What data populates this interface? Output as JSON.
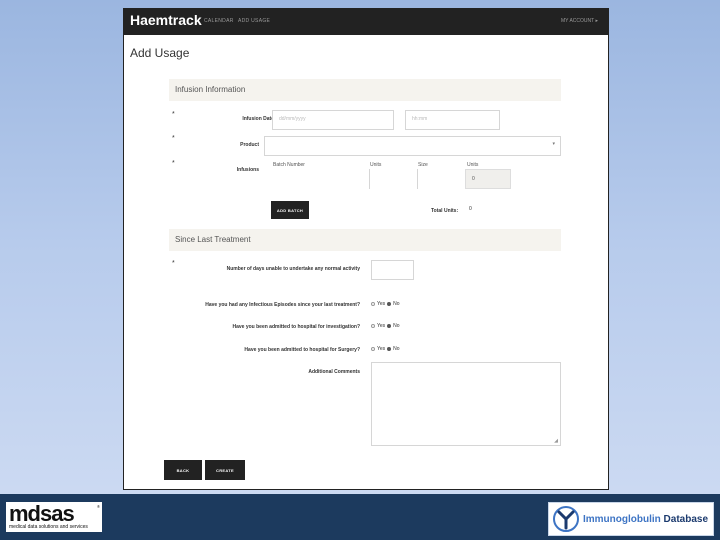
{
  "nav": {
    "brand": "Haemtrack",
    "links": [
      "CALENDAR",
      "ADD USAGE"
    ],
    "account": "MY ACCOUNT ▸"
  },
  "page": {
    "title": "Add Usage"
  },
  "infusion_section": {
    "heading": "Infusion Information",
    "required_mark": "*",
    "date_label": "Infusion Date",
    "date_placeholder": "dd/mm/yyyy",
    "time_placeholder": "hh:mm",
    "product_label": "Product",
    "infusions_label": "Infusions",
    "columns": [
      "Batch Number",
      "Units",
      "Size",
      "Units"
    ],
    "units_value": "0",
    "add_batch_label": "ADD BATCH",
    "total_units_label": "Total Units:",
    "total_units_value": "0"
  },
  "treatment_section": {
    "heading": "Since Last Treatment",
    "days_question": "Number of days unable to undertake any normal activity",
    "questions": [
      {
        "text": "Have you had any Infectious Episodes since your last treatment?",
        "yes": "Yes",
        "no": "No",
        "selected": "No"
      },
      {
        "text": "Have you been admitted to hospital for investigation?",
        "yes": "Yes",
        "no": "No",
        "selected": "No"
      },
      {
        "text": "Have you been admitted to hospital for Surgery?",
        "yes": "Yes",
        "no": "No",
        "selected": "No"
      }
    ],
    "comments_label": "Additional Comments"
  },
  "actions": {
    "back": "BACK",
    "create": "CREATE"
  },
  "footer": {
    "left_logo_name": "mdsas",
    "left_logo_tagline": "medical data solutions and services",
    "right_logo_a": "Immunoglobulin",
    "right_logo_b": "Database"
  },
  "colors": {
    "navbar": "#222222",
    "section": "#f5f3ee",
    "footer": "#1c3a5e",
    "logo_blue": "#3d74c4"
  }
}
